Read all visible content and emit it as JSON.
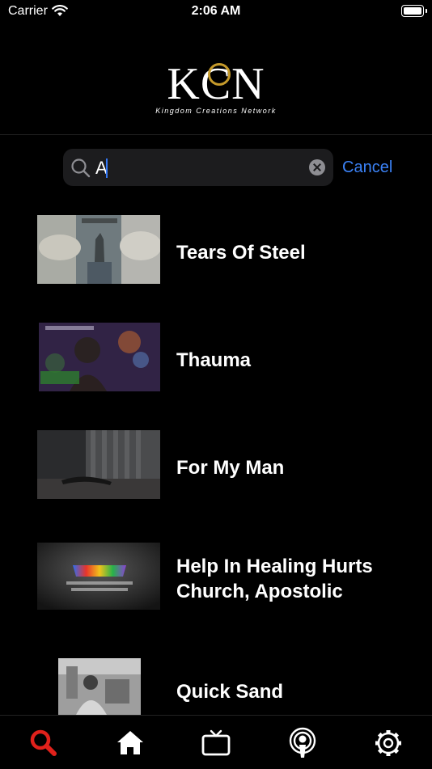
{
  "status_bar": {
    "carrier": "Carrier",
    "time": "2:06 AM"
  },
  "logo": {
    "mark": "KCN",
    "tagline": "Kingdom Creations Network"
  },
  "search": {
    "value": "A",
    "cancel_label": "Cancel"
  },
  "results": [
    {
      "title": "Tears Of Steel",
      "thumb": "tears-of-steel-thumbnail"
    },
    {
      "title": "Thauma",
      "thumb": "thauma-thumbnail"
    },
    {
      "title": "For My Man",
      "thumb": "for-my-man-thumbnail"
    },
    {
      "title_line1": "Help In Healing Hurts",
      "title_line2": "Church, Apostolic",
      "thumb": "help-in-healing-hurts-thumbnail"
    },
    {
      "title": "Quick Sand",
      "thumb": "quick-sand-thumbnail"
    }
  ],
  "tab_bar": {
    "tabs": [
      {
        "icon": "search-icon",
        "active": true
      },
      {
        "icon": "home-icon",
        "active": false
      },
      {
        "icon": "tv-icon",
        "active": false
      },
      {
        "icon": "podcast-icon",
        "active": false
      },
      {
        "icon": "gear-icon",
        "active": false
      }
    ],
    "active_color": "#e0211b",
    "inactive_color": "#ffffff"
  },
  "colors": {
    "accent": "#3b82f6",
    "background": "#000000"
  }
}
